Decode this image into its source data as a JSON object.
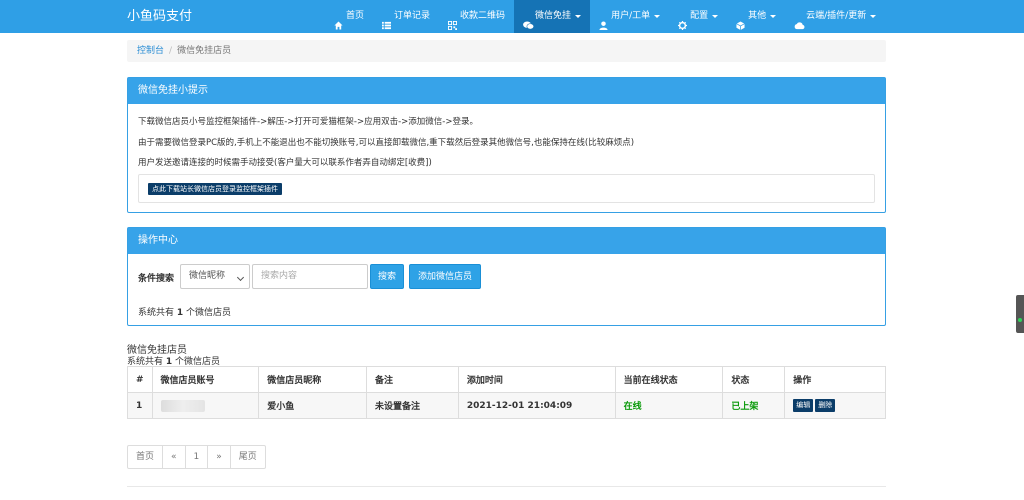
{
  "brand": "小鱼码支付",
  "nav": [
    {
      "label": "首页",
      "icon": "home-icon",
      "dropdown": false,
      "active": false
    },
    {
      "label": "订单记录",
      "icon": "list-icon",
      "dropdown": false,
      "active": false
    },
    {
      "label": "收款二维码",
      "icon": "qrcode-icon",
      "dropdown": false,
      "active": false
    },
    {
      "label": "微信免挂",
      "icon": "wechat-icon",
      "dropdown": true,
      "active": true
    },
    {
      "label": "用户/工单",
      "icon": "user-icon",
      "dropdown": true,
      "active": false
    },
    {
      "label": "配置",
      "icon": "gear-icon",
      "dropdown": true,
      "active": false
    },
    {
      "label": "其他",
      "icon": "cube-icon",
      "dropdown": true,
      "active": false
    },
    {
      "label": "云端/插件/更新",
      "icon": "cloud-icon",
      "dropdown": true,
      "active": false
    }
  ],
  "breadcrumb": {
    "home": "控制台",
    "current": "微信免挂店员"
  },
  "tips": {
    "title": "微信免挂小提示",
    "lines": [
      "下载微信店员小号监控框架插件->解压->打开可爱猫框架->应用双击->添加微信->登录。",
      "由于需要微信登录PC版的,手机上不能退出也不能切换账号,可以直接卸载微信,重下载然后登录其他微信号,也能保持在线(比较麻烦点)",
      "用户发送邀请连接的时候需手动接受(客户量大可以联系作者弄自动绑定[收费])"
    ],
    "download_button": "点此下载站长微信店员登录监控框架插件"
  },
  "ops": {
    "title": "操作中心",
    "condition_label": "条件搜索",
    "select_value": "微信昵称",
    "search_placeholder": "搜索内容",
    "search_button": "搜索",
    "add_button": "添加微信店员",
    "total_prefix": "系统共有 ",
    "total_count": "1",
    "total_suffix": " 个微信店员"
  },
  "list": {
    "title": "微信免挂店员",
    "total_prefix": "系统共有 ",
    "total_count": "1",
    "total_suffix": " 个微信店员",
    "columns": [
      "#",
      "微信店员账号",
      "微信店员昵称",
      "备注",
      "添加时间",
      "当前在线状态",
      "状态",
      "操作"
    ],
    "rows": [
      {
        "id": "1",
        "account": "",
        "nickname": "爱小鱼",
        "remark": "未设置备注",
        "added": "2021-12-01 21:04:09",
        "online": "在线",
        "status": "已上架",
        "edit": "编辑",
        "delete": "删除"
      }
    ]
  },
  "pager": {
    "first": "首页",
    "prev": "«",
    "page": "1",
    "next": "»",
    "last": "尾页"
  },
  "colors": {
    "nav": "#2f9fe6",
    "nav_active": "#1573b5",
    "panel_head": "#37a3e9",
    "dark_btn": "#0b3d69",
    "green": "#0a9a0a"
  }
}
